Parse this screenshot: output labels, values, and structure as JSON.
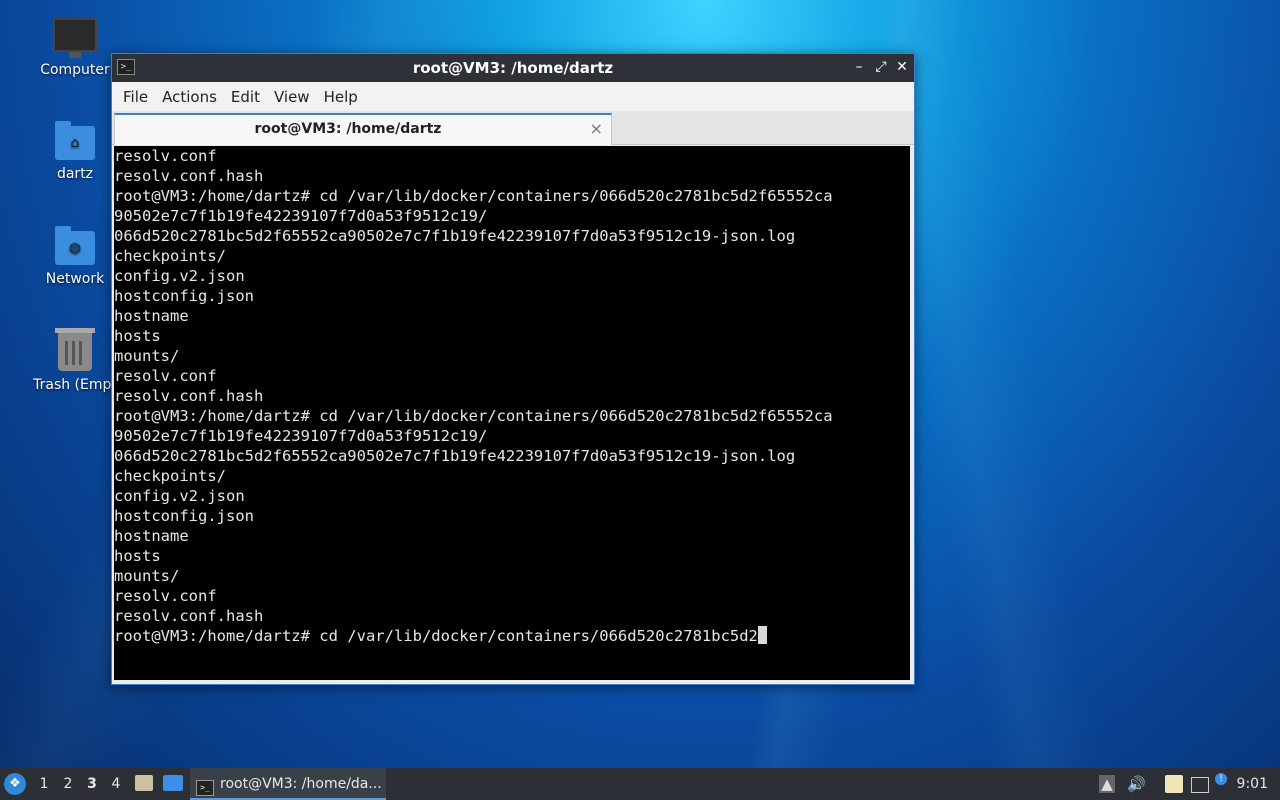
{
  "desktop": {
    "icons": [
      {
        "label": "Computer",
        "icon": "computer-icon"
      },
      {
        "label": "dartz",
        "icon": "home-folder-icon"
      },
      {
        "label": "Network",
        "icon": "network-folder-icon"
      },
      {
        "label": "Trash (Empt",
        "icon": "trash-icon"
      }
    ]
  },
  "window": {
    "title": "root@VM3: /home/dartz",
    "controls": {
      "minimize": "–",
      "maximize": "⤢",
      "close": "✕"
    },
    "menu": [
      "File",
      "Actions",
      "Edit",
      "View",
      "Help"
    ],
    "tab": {
      "title": "root@VM3: /home/dartz",
      "close": "×"
    }
  },
  "terminal": {
    "lines": [
      "resolv.conf",
      "resolv.conf.hash",
      "root@VM3:/home/dartz# cd /var/lib/docker/containers/066d520c2781bc5d2f65552ca",
      "90502e7c7f1b19fe42239107f7d0a53f9512c19/",
      "066d520c2781bc5d2f65552ca90502e7c7f1b19fe42239107f7d0a53f9512c19-json.log",
      "checkpoints/",
      "config.v2.json",
      "hostconfig.json",
      "hostname",
      "hosts",
      "mounts/",
      "resolv.conf",
      "resolv.conf.hash",
      "root@VM3:/home/dartz# cd /var/lib/docker/containers/066d520c2781bc5d2f65552ca",
      "90502e7c7f1b19fe42239107f7d0a53f9512c19/",
      "066d520c2781bc5d2f65552ca90502e7c7f1b19fe42239107f7d0a53f9512c19-json.log",
      "checkpoints/",
      "config.v2.json",
      "hostconfig.json",
      "hostname",
      "hosts",
      "mounts/",
      "resolv.conf",
      "resolv.conf.hash"
    ],
    "prompt_line": "root@VM3:/home/dartz# cd /var/lib/docker/containers/066d520c2781bc5d2"
  },
  "taskbar": {
    "workspaces": [
      "1",
      "2",
      "3",
      "4"
    ],
    "active_workspace": "3",
    "task_label": "root@VM3: /home/da...",
    "clock": "9:01"
  }
}
